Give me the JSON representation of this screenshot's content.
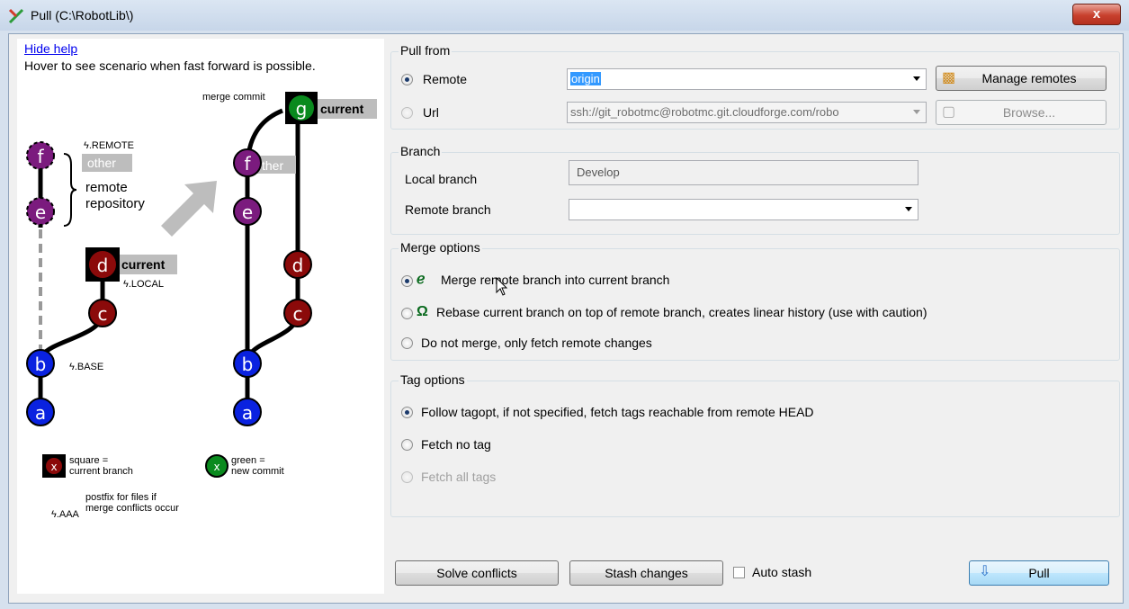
{
  "window": {
    "title": "Pull (C:\\RobotLib\\)",
    "close_label": "x"
  },
  "help": {
    "hide_help": "Hide help",
    "hint": "Hover to see scenario when fast forward is possible.",
    "merge_commit": "merge commit",
    "remote_tag": "ϟ.REMOTE",
    "other": "other",
    "other_right": "ther",
    "remote_repo_1": "remote",
    "remote_repo_2": "repository",
    "current": "current",
    "local_tag": "ϟ.LOCAL",
    "base_tag": "ϟ.BASE",
    "legend_square_1": "square =",
    "legend_square_2": "current branch",
    "legend_green_1": "green =",
    "legend_green_2": "new commit",
    "legend_x": "x",
    "legend_aaa": "ϟ.AAA",
    "legend_postfix_1": "postfix for files if",
    "legend_postfix_2": "merge conflicts occur",
    "nodes": {
      "a": "a",
      "b": "b",
      "c": "c",
      "d": "d",
      "e": "e",
      "f": "f",
      "g": "g"
    }
  },
  "pull_from": {
    "title": "Pull from",
    "remote_label": "Remote",
    "remote_value": "origin",
    "url_label": "Url",
    "url_value": "ssh://git_robotmc@robotmc.git.cloudforge.com/robo",
    "manage_remotes": "Manage remotes",
    "browse": "Browse..."
  },
  "branch": {
    "title": "Branch",
    "local_label": "Local branch",
    "local_value": "Develop",
    "remote_label": "Remote branch",
    "remote_value": ""
  },
  "merge_options": {
    "title": "Merge options",
    "merge": "Merge remote branch into current branch",
    "rebase": "Rebase current branch on top of remote branch, creates linear history (use with caution)",
    "fetch_only": "Do not merge, only fetch remote changes"
  },
  "tag_options": {
    "title": "Tag options",
    "follow": "Follow tagopt, if not specified, fetch tags reachable from remote HEAD",
    "no_tag": "Fetch no tag",
    "all_tags": "Fetch all tags"
  },
  "footer": {
    "solve_conflicts": "Solve conflicts",
    "stash_changes": "Stash changes",
    "auto_stash": "Auto stash",
    "pull": "Pull"
  },
  "colors": {
    "purple": "#7b1b7e",
    "darkred": "#8b0a0a",
    "blue": "#0a22e0",
    "green": "#0a8a1e"
  }
}
